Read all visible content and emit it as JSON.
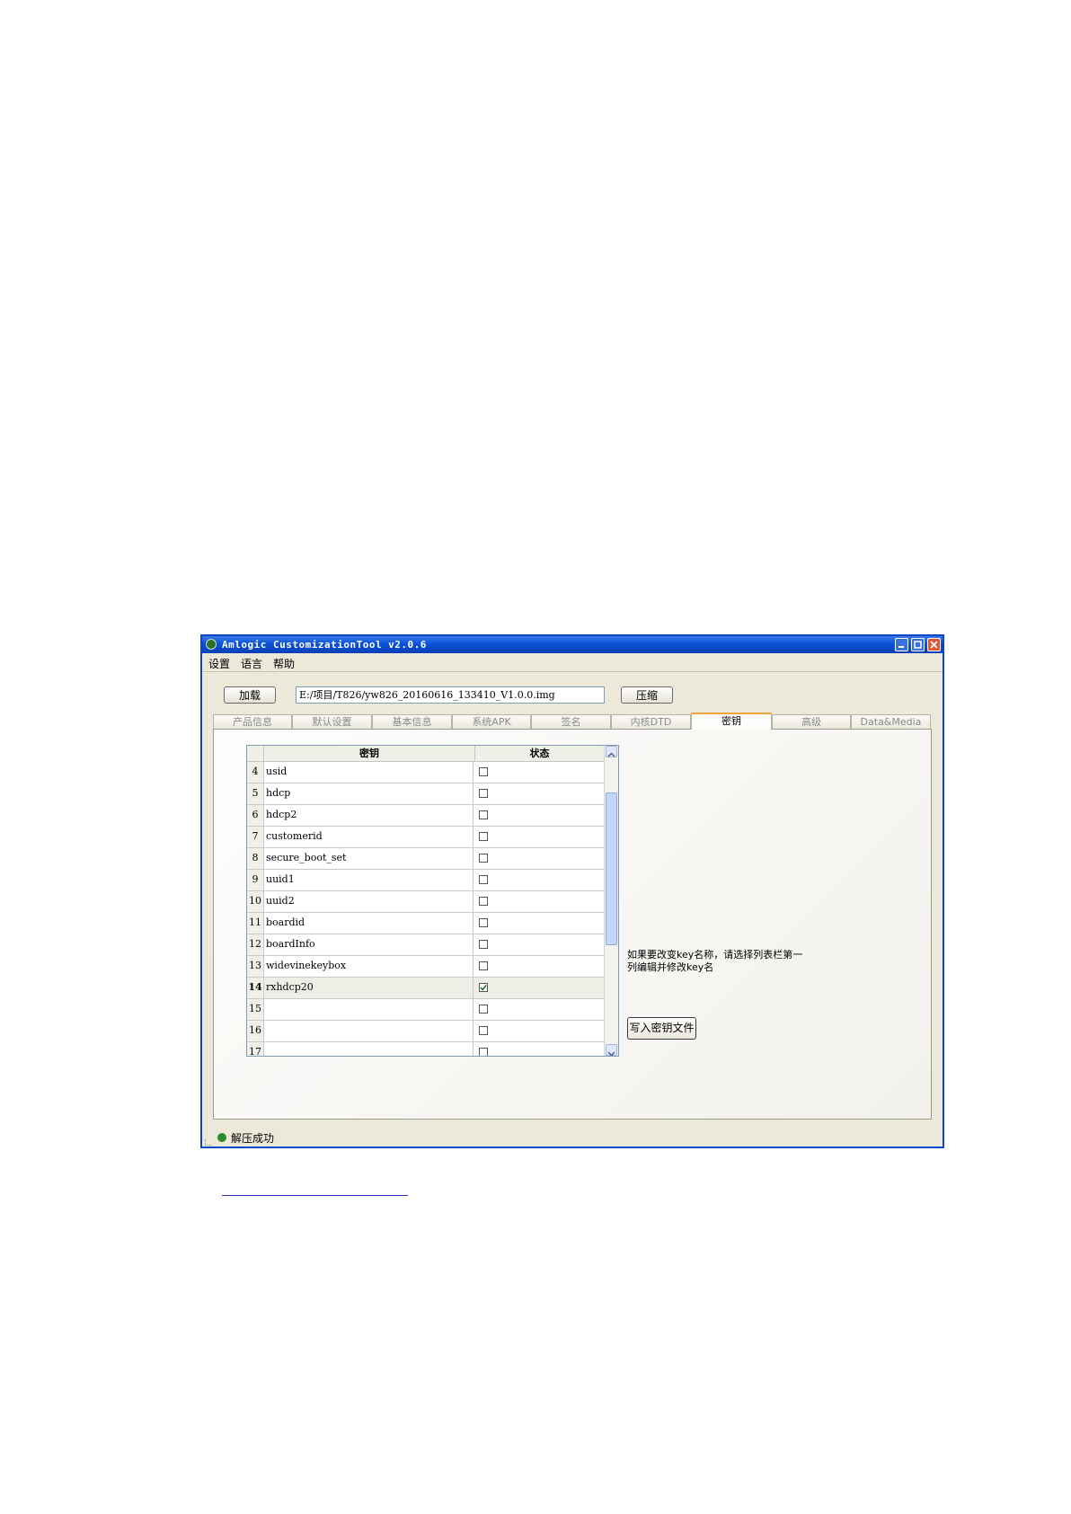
{
  "window": {
    "title": "Amlogic CustomizationTool v2.0.6",
    "colors": {
      "titlebar": "#0b52d8",
      "active_tab_accent": "#f2a33a",
      "status_ok": "#2e8b2e"
    }
  },
  "menu": [
    "设置",
    "语言",
    "帮助"
  ],
  "toolbar": {
    "load_label": "加载",
    "path_value": "E:/项目/T826/yw826_20160616_133410_V1.0.0.img",
    "compress_label": "压缩"
  },
  "tabs": [
    {
      "label": "产品信息",
      "active": false
    },
    {
      "label": "默认设置",
      "active": false
    },
    {
      "label": "基本信息",
      "active": false
    },
    {
      "label": "系统APK",
      "active": false
    },
    {
      "label": "签名",
      "active": false
    },
    {
      "label": "内核DTD",
      "active": false
    },
    {
      "label": "密钥",
      "active": true
    },
    {
      "label": "高级",
      "active": false
    },
    {
      "label": "Data&Media",
      "active": false
    }
  ],
  "key_table": {
    "headers": {
      "key": "密钥",
      "status": "状态"
    },
    "rows": [
      {
        "num": "4",
        "key": "usid",
        "checked": false
      },
      {
        "num": "5",
        "key": "hdcp",
        "checked": false
      },
      {
        "num": "6",
        "key": "hdcp2",
        "checked": false
      },
      {
        "num": "7",
        "key": "customerid",
        "checked": false
      },
      {
        "num": "8",
        "key": "secure_boot_set",
        "checked": false
      },
      {
        "num": "9",
        "key": "uuid1",
        "checked": false
      },
      {
        "num": "10",
        "key": "uuid2",
        "checked": false
      },
      {
        "num": "11",
        "key": "boardid",
        "checked": false
      },
      {
        "num": "12",
        "key": "boardInfo",
        "checked": false
      },
      {
        "num": "13",
        "key": "widevinekeybox",
        "checked": false
      },
      {
        "num": "14",
        "key": "rxhdcp20",
        "checked": true,
        "selected": true
      },
      {
        "num": "15",
        "key": "",
        "checked": false
      },
      {
        "num": "16",
        "key": "",
        "checked": false
      },
      {
        "num": "17",
        "key": "",
        "checked": false
      }
    ]
  },
  "hint": {
    "line1": "如果要改变key名称，请选择列表栏第一",
    "line2": "列编辑并修改key名"
  },
  "write_key_button": "写入密钥文件",
  "status": {
    "text": "解压成功"
  }
}
